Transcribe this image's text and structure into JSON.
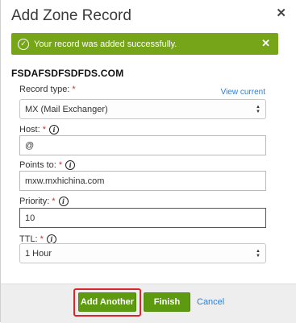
{
  "dialog": {
    "title": "Add Zone Record",
    "close_icon": "close-icon"
  },
  "alert": {
    "message": "Your record was added successfully.",
    "check_icon": "check-circle-icon",
    "close_icon": "close-icon",
    "color": "#76a51a"
  },
  "domain": "FSDAFSDFSDFDS.COM",
  "form": {
    "record_type": {
      "label": "Record type:",
      "required": "*",
      "value": "MX (Mail Exchanger)",
      "view_current": "View current"
    },
    "host": {
      "label": "Host:",
      "required": "*",
      "value": "@"
    },
    "points_to": {
      "label": "Points to:",
      "required": "*",
      "value": "mxw.mxhichina.com"
    },
    "priority": {
      "label": "Priority:",
      "required": "*",
      "value": "10"
    },
    "ttl": {
      "label": "TTL:",
      "required": "*",
      "value": "1 Hour"
    }
  },
  "footer": {
    "add_another": "Add Another",
    "finish": "Finish",
    "cancel": "Cancel",
    "button_color": "#5d9a0f",
    "highlight_color": "#d9262c"
  }
}
